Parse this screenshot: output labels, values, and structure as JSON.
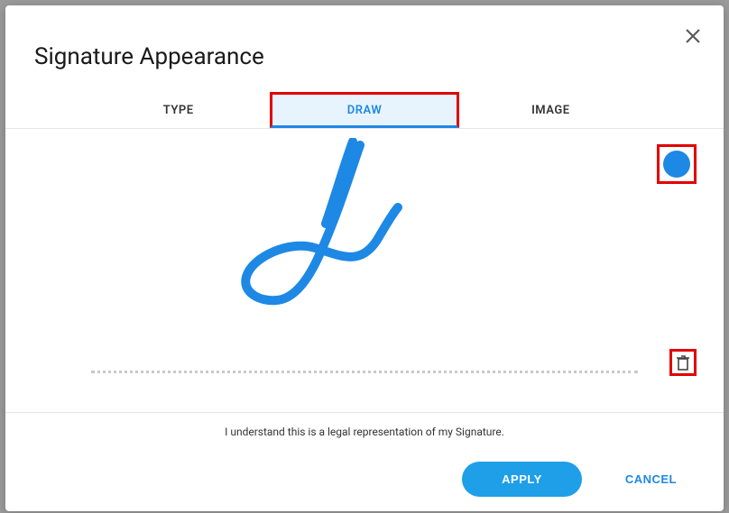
{
  "title": "Signature Appearance",
  "tabs": {
    "type": "TYPE",
    "draw": "DRAW",
    "image": "IMAGE",
    "active": "draw"
  },
  "colors": {
    "signature_stroke": "#1e88e5",
    "active_color_swatch": "#1e88e5",
    "highlight_border": "#e20000"
  },
  "legal_text": "I understand this is a legal representation of my Signature.",
  "buttons": {
    "apply": "APPLY",
    "cancel": "CANCEL"
  },
  "icons": {
    "close": "close-icon",
    "delete": "delete-icon",
    "color": "color-swatch-icon"
  }
}
